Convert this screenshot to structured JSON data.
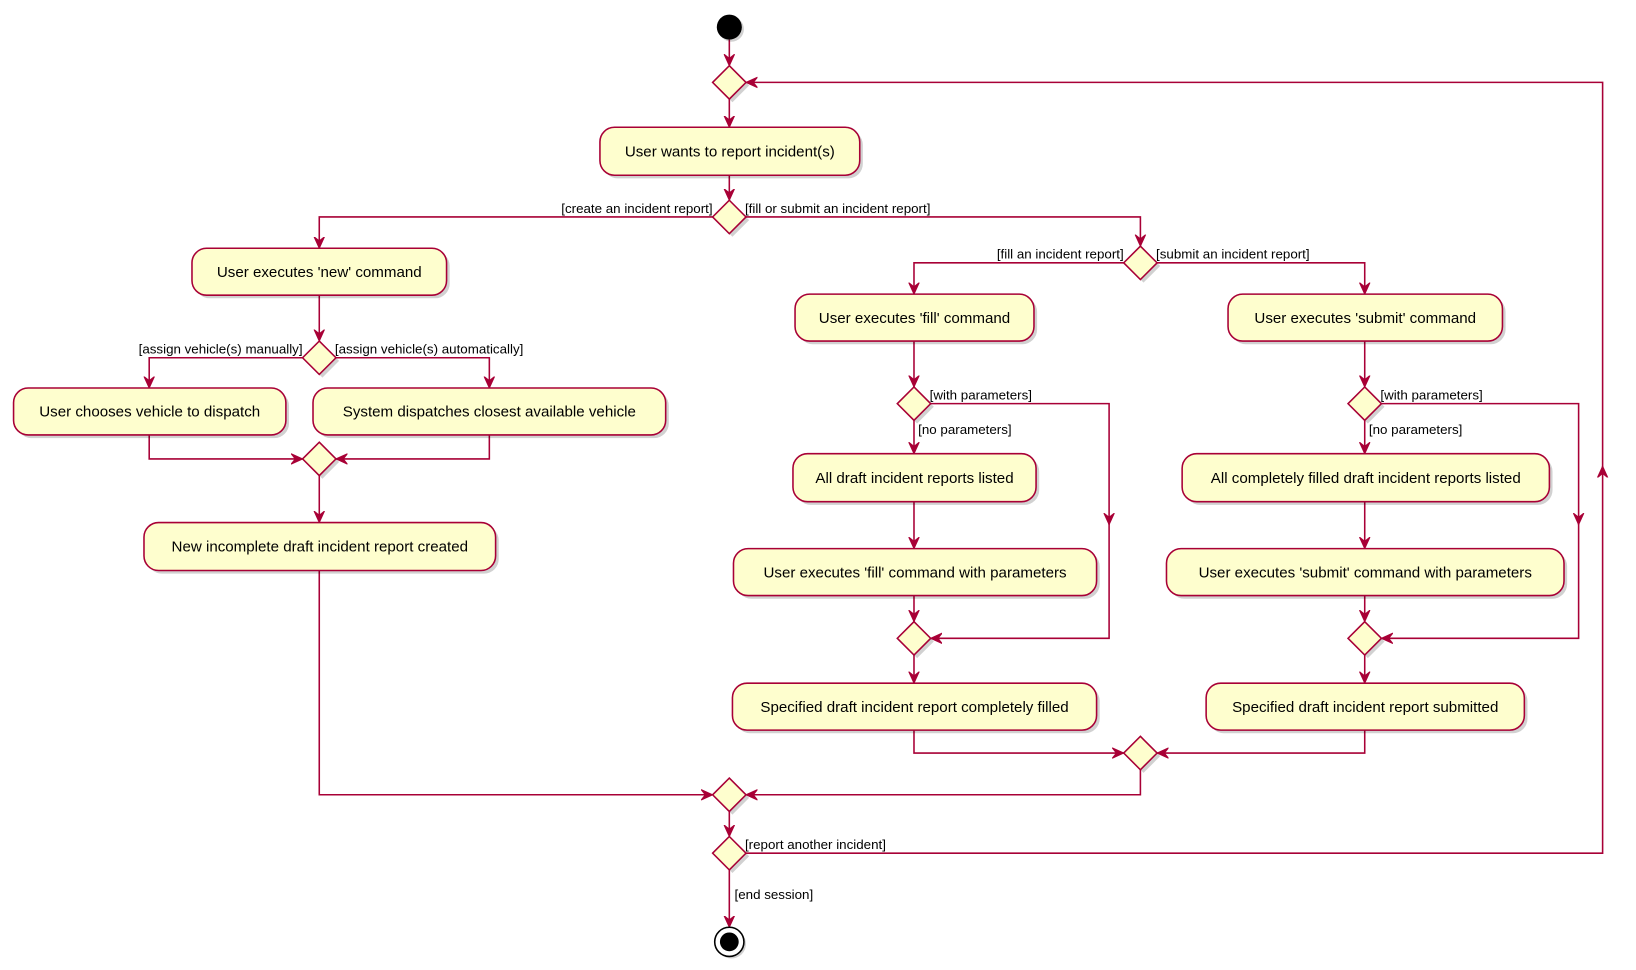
{
  "colors": {
    "stroke": "#A80036",
    "fill": "#FEFECE",
    "background": "#FFFFFF"
  },
  "activities": {
    "wants_report": "User wants to report incident(s)",
    "exec_new": "User executes 'new' command",
    "choose_vehicle": "User chooses vehicle to dispatch",
    "system_dispatch": "System dispatches closest available vehicle",
    "draft_created": "New incomplete draft incident report created",
    "exec_fill": "User executes 'fill' command",
    "exec_submit": "User executes 'submit' command",
    "drafts_listed": "All draft incident reports listed",
    "filled_listed": "All completely filled draft incident reports listed",
    "exec_fill_params": "User executes 'fill' command with parameters",
    "exec_submit_params": "User executes 'submit' command with parameters",
    "report_filled": "Specified draft incident report completely filled",
    "report_submitted": "Specified draft incident report submitted"
  },
  "guards": {
    "create": "[create an incident report]",
    "fill_or_submit": "[fill or submit an incident report]",
    "assign_manual": "[assign vehicle(s) manually]",
    "assign_auto": "[assign vehicle(s) automatically]",
    "fill": "[fill an incident report]",
    "submit": "[submit an incident report]",
    "fill_with_params": "[with parameters]",
    "fill_no_params": "[no parameters]",
    "submit_with_params": "[with parameters]",
    "submit_no_params": "[no parameters]",
    "report_another": "[report another incident]",
    "end_session": "[end session]"
  }
}
